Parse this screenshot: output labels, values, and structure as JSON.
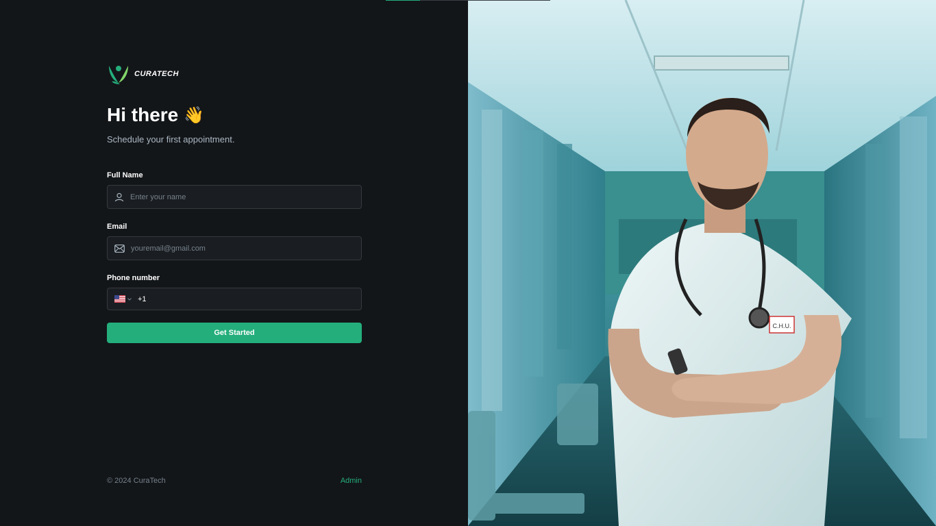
{
  "brand": {
    "name": "CURATECH",
    "accent": "#24ae7c",
    "logo_icon": "leaf-person-logo"
  },
  "hero": {
    "title": "Hi there",
    "emoji": "👋",
    "subtitle": "Schedule your first appointment."
  },
  "form": {
    "full_name": {
      "label": "Full Name",
      "placeholder": "Enter your name",
      "icon": "user-icon"
    },
    "email": {
      "label": "Email",
      "placeholder": "youremail@gmail.com",
      "icon": "mail-icon"
    },
    "phone": {
      "label": "Phone number",
      "code": "+1",
      "flag": "us-flag-icon"
    },
    "submit_label": "Get Started"
  },
  "footer": {
    "copyright": "© 2024 CuraTech",
    "admin_label": "Admin"
  },
  "colors": {
    "background": "#131619",
    "input_bg": "#1a1d21",
    "input_border": "#363a3d",
    "muted": "#76828d"
  },
  "progress": {
    "fraction": 0.21
  }
}
